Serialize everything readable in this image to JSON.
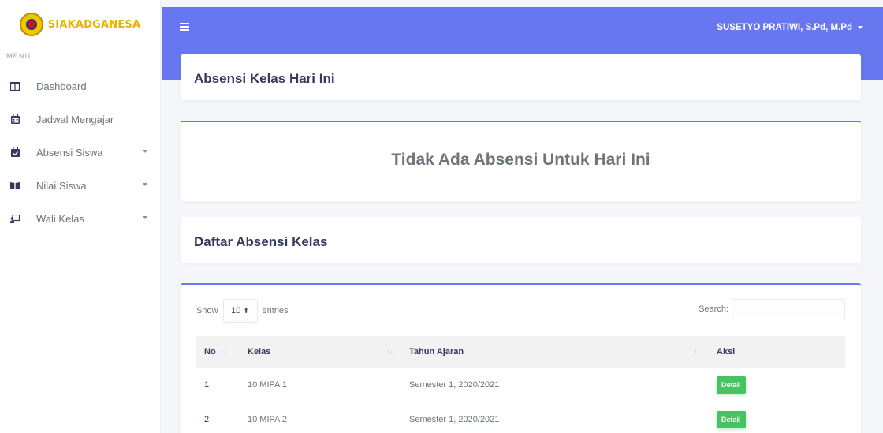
{
  "brand": {
    "name": "SIAKADGANESA"
  },
  "menu": {
    "title": "MENU",
    "items": [
      {
        "label": "Dashboard",
        "icon": "columns-icon",
        "dropdown": false
      },
      {
        "label": "Jadwal Mengajar",
        "icon": "calendar-icon",
        "dropdown": false
      },
      {
        "label": "Absensi Siswa",
        "icon": "calendar-check-icon",
        "dropdown": true
      },
      {
        "label": "Nilai Siswa",
        "icon": "book-open-icon",
        "dropdown": true
      },
      {
        "label": "Wali Kelas",
        "icon": "chalkboard-teacher-icon",
        "dropdown": true
      }
    ]
  },
  "header": {
    "user_name": "SUSETYO PRATIWI, S.Pd, M.Pd"
  },
  "section_absensi": {
    "title": "Absensi Kelas Hari Ini",
    "empty_message": "Tidak Ada Absensi Untuk Hari Ini"
  },
  "section_daftar": {
    "title": "Daftar Absensi Kelas",
    "show_label": "Show",
    "entries_value": "10",
    "entries_label": "entries",
    "search_label": "Search:",
    "search_value": "",
    "columns": [
      "No",
      "Kelas",
      "Tahun Ajaran",
      "Aksi"
    ],
    "rows": [
      {
        "no": "1",
        "kelas": "10 MIPA 1",
        "tahun": "Semester 1, 2020/2021",
        "aksi": "Detail"
      },
      {
        "no": "2",
        "kelas": "10 MIPA 2",
        "tahun": "Semester 1, 2020/2021",
        "aksi": "Detail"
      }
    ]
  },
  "colors": {
    "primary": "#6777ef",
    "success": "#47c363",
    "brand_yellow": "#e8b400"
  }
}
